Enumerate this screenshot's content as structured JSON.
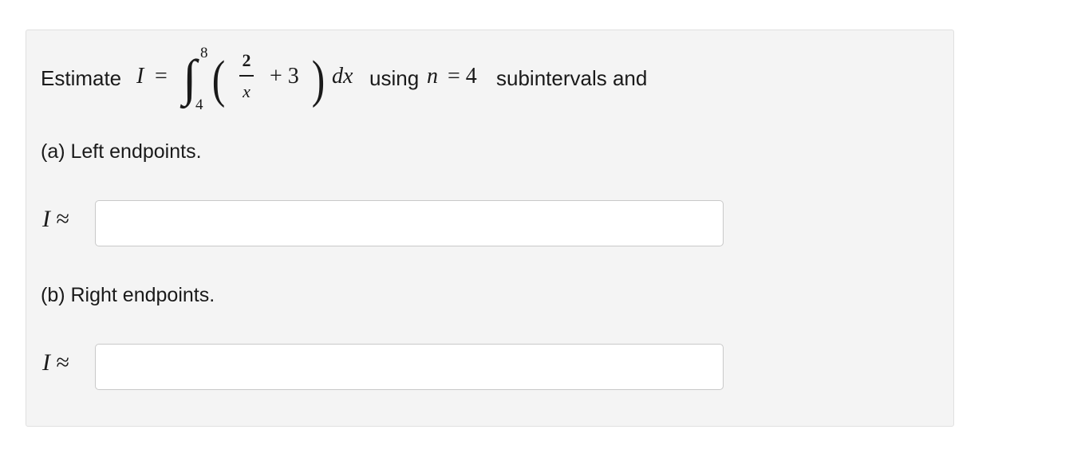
{
  "question": {
    "estimate_word": "Estimate",
    "I_symbol": "I",
    "equals": "=",
    "integral_sign": "∫",
    "upper_limit": "8",
    "lower_limit": "4",
    "left_paren": "(",
    "right_paren": ")",
    "frac_numerator": "2",
    "frac_denominator": "x",
    "plus_term": "+ 3",
    "dx": "dx",
    "using_word": "using",
    "n_symbol": "n",
    "n_equals": "= 4",
    "trailing_text": "subintervals and"
  },
  "parts": [
    {
      "label": "(a) Left endpoints.",
      "answer_prefix_I": "I",
      "answer_prefix_approx": "≈",
      "input_value": ""
    },
    {
      "label": "(b) Right endpoints.",
      "answer_prefix_I": "I",
      "answer_prefix_approx": "≈",
      "input_value": ""
    }
  ],
  "colors": {
    "panel_background": "#f4f4f4",
    "panel_border": "#e0e0e0",
    "input_border": "#c9c9c9",
    "text": "#1a1a1a"
  }
}
